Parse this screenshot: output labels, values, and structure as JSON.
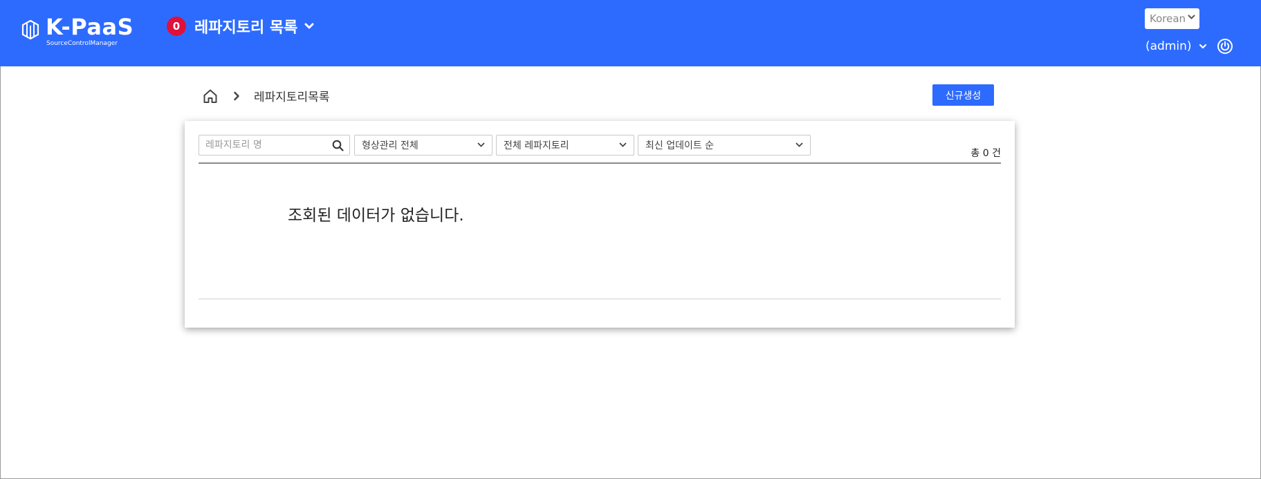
{
  "header": {
    "logo_text": "K-PaaS",
    "logo_subtitle": "SourceControlManager",
    "badge_count": "0",
    "menu_title": "레파지토리 목록",
    "language": "Korean",
    "user": "(admin)"
  },
  "breadcrumb": {
    "current": "레파지토리목록"
  },
  "actions": {
    "new_button": "신규생성"
  },
  "filters": {
    "search_placeholder": "레파지토리 명",
    "scm_type": "형상관리 전체",
    "repo_scope": "전체 레파지토리",
    "sort": "최신 업데이트 순"
  },
  "list": {
    "total_label": "총 0 건",
    "empty_message": "조회된 데이터가 없습니다."
  },
  "colors": {
    "brand": "#2d6bff",
    "badge": "#e0103a"
  },
  "icons": [
    "logo-cube-icon",
    "chevron-down-icon",
    "power-icon",
    "home-icon",
    "chevron-right-icon",
    "search-icon"
  ]
}
